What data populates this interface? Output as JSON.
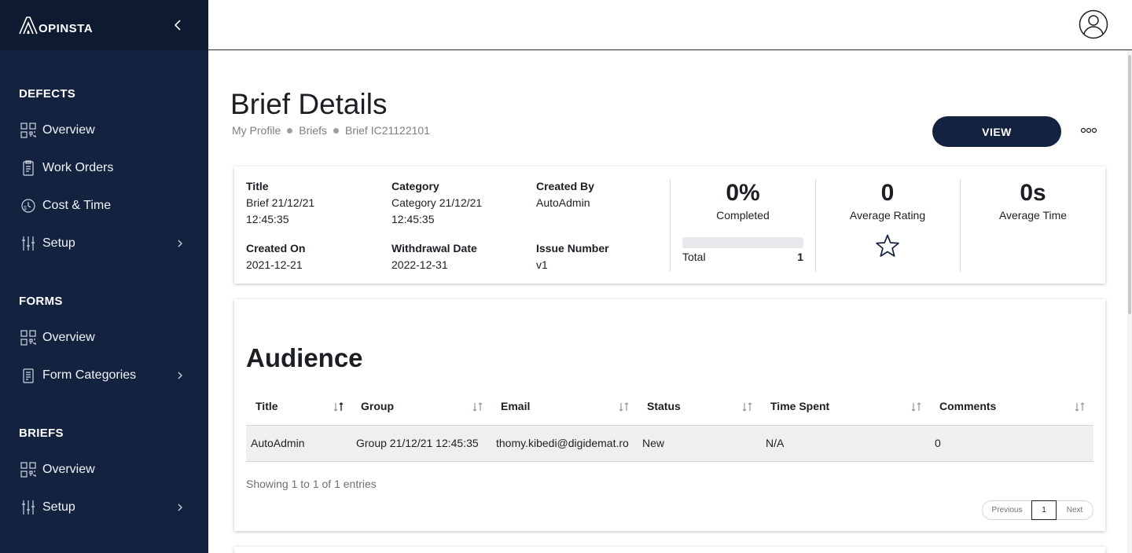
{
  "app": {
    "logo_text": "OPINSTA"
  },
  "sidebar": {
    "sections": [
      {
        "title": "DEFECTS"
      },
      {
        "title": "FORMS"
      },
      {
        "title": "BRIEFS"
      }
    ],
    "items": [
      {
        "label": "Overview",
        "icon": "qr-grid-icon"
      },
      {
        "label": "Work Orders",
        "icon": "clipboard-icon"
      },
      {
        "label": "Cost & Time",
        "icon": "money-clock-icon"
      },
      {
        "label": "Setup",
        "icon": "sliders-icon"
      },
      {
        "label": "Overview",
        "icon": "qr-grid-icon"
      },
      {
        "label": "Form Categories",
        "icon": "form-icon"
      },
      {
        "label": "Overview",
        "icon": "qr-grid-icon"
      },
      {
        "label": "Setup",
        "icon": "sliders-icon"
      }
    ]
  },
  "header": {
    "title": "Brief Details",
    "breadcrumb": [
      "My Profile",
      "Briefs",
      "Brief IC21122101"
    ],
    "view_label": "VIEW"
  },
  "info": {
    "title_label": "Title",
    "title_value": "Brief 21/12/21 12:45:35",
    "category_label": "Category",
    "category_value": "Category 21/12/21 12:45:35",
    "created_by_label": "Created By",
    "created_by_value": "AutoAdmin",
    "created_on_label": "Created On",
    "created_on_value": "2021-12-21",
    "withdrawal_label": "Withdrawal Date",
    "withdrawal_value": "2022-12-31",
    "issue_label": "Issue Number",
    "issue_value": "v1"
  },
  "stats": {
    "completed_value": "0%",
    "completed_label": "Completed",
    "completed_fraction": 0,
    "total_label": "Total",
    "total_value": "1",
    "rating_value": "0",
    "rating_label": "Average Rating",
    "time_value": "0s",
    "time_label": "Average Time"
  },
  "audience": {
    "title": "Audience",
    "columns": [
      "Title",
      "Group",
      "Email",
      "Status",
      "Time Spent",
      "Comments"
    ],
    "rows": [
      [
        "AutoAdmin",
        "Group 21/12/21 12:45:35",
        "thomy.kibedi@digidemat.ro",
        "New",
        "N/A",
        "0"
      ]
    ],
    "showing": "Showing 1 to 1 of 1 entries",
    "pager": {
      "previous": "Previous",
      "current": "1",
      "next": "Next"
    }
  },
  "colors": {
    "sidebar_bg": "#13233f",
    "sidebar_head_bg": "#0e1a30",
    "accent": "#13233f"
  }
}
